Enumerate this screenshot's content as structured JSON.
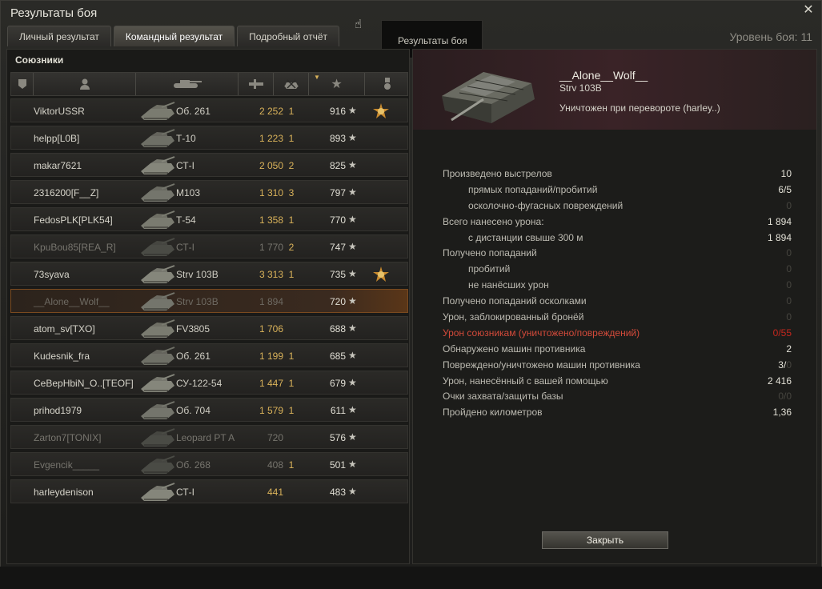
{
  "window": {
    "title": "Результаты боя",
    "close": "✕"
  },
  "tabs": [
    {
      "label": "Личный результат",
      "active": false
    },
    {
      "label": "Командный результат",
      "active": true
    },
    {
      "label": "Подробный отчёт",
      "active": false
    }
  ],
  "tooltip": "Результаты боя",
  "battle_level": "Уровень боя: 11",
  "allies": {
    "label": "Союзники",
    "columns": [
      "squad-icon",
      "player-icon",
      "tank-icon",
      "damage-icon",
      "kills-icon",
      "xp-star-icon",
      "medal-icon"
    ],
    "rows": [
      {
        "player": "ViktorUSSR",
        "vehicle": "Об. 261",
        "damage": "2 252",
        "kills": "1",
        "xp": "916",
        "medal": true,
        "status": "alive"
      },
      {
        "player": "helpp[L0B]",
        "vehicle": "Т-10",
        "damage": "1 223",
        "kills": "1",
        "xp": "893",
        "medal": false,
        "status": "alive"
      },
      {
        "player": "makar7621",
        "vehicle": "СТ-I",
        "damage": "2 050",
        "kills": "2",
        "xp": "825",
        "medal": false,
        "status": "alive"
      },
      {
        "player": "2316200[F__Z]",
        "vehicle": "M103",
        "damage": "1 310",
        "kills": "3",
        "xp": "797",
        "medal": false,
        "status": "alive"
      },
      {
        "player": "FedosPLK[PLK54]",
        "vehicle": "Т-54",
        "damage": "1 358",
        "kills": "1",
        "xp": "770",
        "medal": false,
        "status": "alive"
      },
      {
        "player": "KpuBou85[REA_R]",
        "vehicle": "СТ-I",
        "damage": "1 770",
        "kills": "2",
        "xp": "747",
        "medal": false,
        "status": "dead"
      },
      {
        "player": "73syava",
        "vehicle": "Strv 103B",
        "damage": "3 313",
        "kills": "1",
        "xp": "735",
        "medal": true,
        "status": "alive"
      },
      {
        "player": "__Alone__Wolf__",
        "vehicle": "Strv 103B",
        "damage": "1 894",
        "kills": "",
        "xp": "720",
        "medal": false,
        "status": "self"
      },
      {
        "player": "atom_sv[TXO]",
        "vehicle": "FV3805",
        "damage": "1 706",
        "kills": "",
        "xp": "688",
        "medal": false,
        "status": "alive"
      },
      {
        "player": "Kudesnik_fra",
        "vehicle": "Об. 261",
        "damage": "1 199",
        "kills": "1",
        "xp": "685",
        "medal": false,
        "status": "alive"
      },
      {
        "player": "CeBepHbiN_O..[TEOF]",
        "vehicle": "СУ-122-54",
        "damage": "1 447",
        "kills": "1",
        "xp": "679",
        "medal": false,
        "status": "alive"
      },
      {
        "player": "prihod1979",
        "vehicle": "Об. 704",
        "damage": "1 579",
        "kills": "1",
        "xp": "611",
        "medal": false,
        "status": "alive"
      },
      {
        "player": "Zarton7[TONIX]",
        "vehicle": "Leopard PT A",
        "damage": "720",
        "kills": "",
        "xp": "576",
        "medal": false,
        "status": "dead"
      },
      {
        "player": "Evgencik_____",
        "vehicle": "Об. 268",
        "damage": "408",
        "kills": "1",
        "xp": "501",
        "medal": false,
        "status": "dead"
      },
      {
        "player": "harleydenison",
        "vehicle": "СТ-I",
        "damage": "441",
        "kills": "",
        "xp": "483",
        "medal": false,
        "status": "alive"
      }
    ]
  },
  "detail": {
    "player_name": "__Alone__Wolf__",
    "vehicle": "Strv 103B",
    "fate": "Уничтожен при перевороте (harley..)",
    "stats": [
      {
        "label": "Произведено выстрелов",
        "value": "10",
        "sub": false,
        "style": "normal"
      },
      {
        "label": "прямых попаданий/пробитий",
        "value": "6/5",
        "sub": true,
        "style": "normal"
      },
      {
        "label": "осколочно-фугасных повреждений",
        "value": "0",
        "sub": true,
        "style": "zero"
      },
      {
        "label": "Всего нанесено урона:",
        "value": "1 894",
        "sub": false,
        "style": "normal"
      },
      {
        "label": "с дистанции свыше 300 м",
        "value": "1 894",
        "sub": true,
        "style": "normal"
      },
      {
        "label": "Получено попаданий",
        "value": "0",
        "sub": false,
        "style": "zero"
      },
      {
        "label": "пробитий",
        "value": "0",
        "sub": true,
        "style": "zero"
      },
      {
        "label": "не нанёсших урон",
        "value": "0",
        "sub": true,
        "style": "zero"
      },
      {
        "label": "Получено попаданий осколками",
        "value": "0",
        "sub": false,
        "style": "zero"
      },
      {
        "label": "Урон, заблокированный бронёй",
        "value": "0",
        "sub": false,
        "style": "zero"
      },
      {
        "label": "Урон союзникам (уничтожено/повреждений)",
        "value": "0/55",
        "sub": false,
        "style": "red"
      },
      {
        "label": "Обнаружено машин противника",
        "value": "2",
        "sub": false,
        "style": "normal"
      },
      {
        "label": "Повреждено/уничтожено машин противника",
        "value": "3/0",
        "sub": false,
        "style": "split"
      },
      {
        "label": "Урон, нанесённый с вашей помощью",
        "value": "2 416",
        "sub": false,
        "style": "normal"
      },
      {
        "label": "Очки захвата/защиты базы",
        "value": "0/0",
        "sub": false,
        "style": "zero"
      },
      {
        "label": "Пройдено километров",
        "value": "1,36",
        "sub": false,
        "style": "normal"
      }
    ],
    "close_button": "Закрыть"
  },
  "colors": {
    "damage": "#d9b25a",
    "accent_self": "#7a4a1f",
    "team_damage": "#c4271e"
  }
}
